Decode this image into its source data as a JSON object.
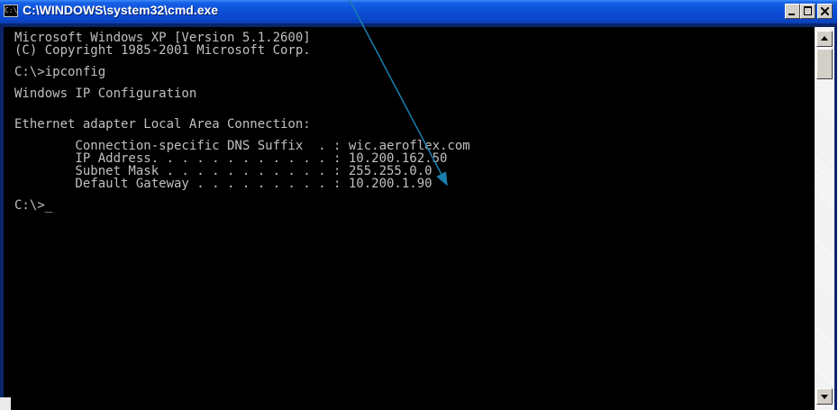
{
  "window": {
    "title": "C:\\WINDOWS\\system32\\cmd.exe",
    "icon": "cmd-icon",
    "icon_glyph": "C:\\",
    "controls": [
      "minimize-icon",
      "maximize-icon",
      "close-icon"
    ]
  },
  "console": {
    "lines": [
      "Microsoft Windows XP [Version 5.1.2600]",
      "(C) Copyright 1985-2001 Microsoft Corp.",
      "",
      "C:\\>ipconfig",
      "",
      "Windows IP Configuration",
      "",
      "",
      "Ethernet adapter Local Area Connection:",
      "",
      "        Connection-specific DNS Suffix  . : wic.aeroflex.com",
      "        IP Address. . . . . . . . . . . . : 10.200.162.50",
      "        Subnet Mask . . . . . . . . . . . : 255.255.0.0",
      "        Default Gateway . . . . . . . . . : 10.200.1.90",
      "",
      "C:\\>_"
    ],
    "colors": {
      "background": "#000000",
      "text": "#c0c0c0"
    }
  },
  "colors": {
    "titlebar": "#0a47c9",
    "annotation_arrow": "#1a7fb0"
  }
}
